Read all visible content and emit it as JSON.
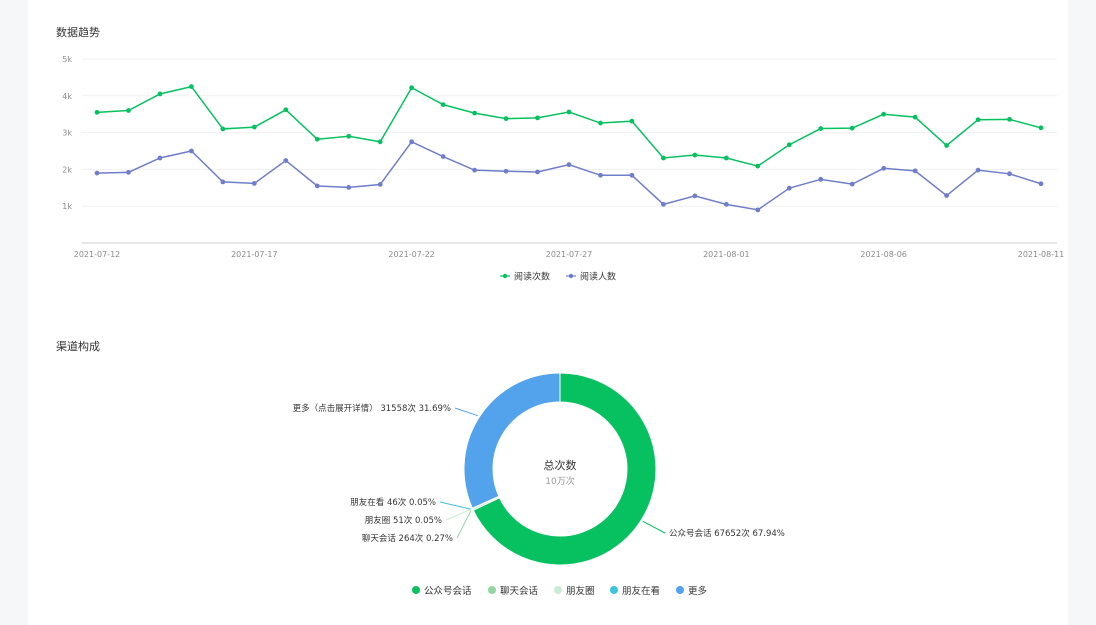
{
  "sections": {
    "trend_title": "数据趋势",
    "channel_title": "渠道构成"
  },
  "colors": {
    "green": "#07c160",
    "purple": "#6f7dcb",
    "pie_green": "#07c160",
    "pie_lightgreen": "#91d5a0",
    "pie_palegreen": "#c8ecd2",
    "pie_cyan": "#3bc4dc",
    "pie_blue": "#52a3eb"
  },
  "chart_data": [
    {
      "type": "line",
      "title": "数据趋势",
      "x": [
        "2021-07-12",
        "2021-07-13",
        "2021-07-14",
        "2021-07-15",
        "2021-07-16",
        "2021-07-17",
        "2021-07-18",
        "2021-07-19",
        "2021-07-20",
        "2021-07-21",
        "2021-07-22",
        "2021-07-23",
        "2021-07-24",
        "2021-07-25",
        "2021-07-26",
        "2021-07-27",
        "2021-07-28",
        "2021-07-29",
        "2021-07-30",
        "2021-07-31",
        "2021-08-01",
        "2021-08-02",
        "2021-08-03",
        "2021-08-04",
        "2021-08-05",
        "2021-08-06",
        "2021-08-07",
        "2021-08-08",
        "2021-08-09",
        "2021-08-10",
        "2021-08-11"
      ],
      "x_tick_labels": [
        "2021-07-12",
        "2021-07-17",
        "2021-07-22",
        "2021-07-27",
        "2021-08-01",
        "2021-08-06",
        "2021-08-11"
      ],
      "y_tick_labels": [
        "1k",
        "2k",
        "3k",
        "4k",
        "5k"
      ],
      "ylim": [
        0,
        5000
      ],
      "grid": true,
      "legend_position": "bottom-center",
      "series": [
        {
          "name": "阅读次数",
          "color": "#07c160",
          "values": [
            3550,
            3600,
            4050,
            4250,
            3100,
            3150,
            3620,
            2820,
            2900,
            2750,
            4220,
            3760,
            3530,
            3380,
            3400,
            3560,
            3260,
            3310,
            2310,
            2390,
            2310,
            2090,
            2670,
            3110,
            3120,
            3500,
            3420,
            2650,
            3350,
            3360,
            3130
          ]
        },
        {
          "name": "阅读人数",
          "color": "#6f7dcb",
          "values": [
            1900,
            1920,
            2310,
            2500,
            1660,
            1620,
            2240,
            1550,
            1510,
            1590,
            2750,
            2350,
            1980,
            1950,
            1930,
            2130,
            1840,
            1840,
            1050,
            1280,
            1050,
            900,
            1490,
            1730,
            1600,
            2030,
            1960,
            1290,
            1980,
            1880,
            1610
          ]
        }
      ]
    },
    {
      "type": "pie",
      "title": "渠道构成",
      "center_title": "总次数",
      "center_subtitle": "10万次",
      "legend_position": "bottom-center",
      "slices": [
        {
          "name": "公众号会话",
          "value": 67652,
          "percent": "67.94%",
          "label": "公众号会话 67652次 67.94%",
          "color": "#07c160"
        },
        {
          "name": "聊天会话",
          "value": 264,
          "percent": "0.27%",
          "label": "聊天会话 264次 0.27%",
          "color": "#91d5a0"
        },
        {
          "name": "朋友圈",
          "value": 51,
          "percent": "0.05%",
          "label": "朋友圈 51次 0.05%",
          "color": "#c8ecd2"
        },
        {
          "name": "朋友在看",
          "value": 46,
          "percent": "0.05%",
          "label": "朋友在看 46次 0.05%",
          "color": "#3bc4dc"
        },
        {
          "name": "更多",
          "value": 31558,
          "percent": "31.69%",
          "label": "更多（点击展开详情） 31558次 31.69%",
          "color": "#52a3eb"
        }
      ]
    }
  ]
}
